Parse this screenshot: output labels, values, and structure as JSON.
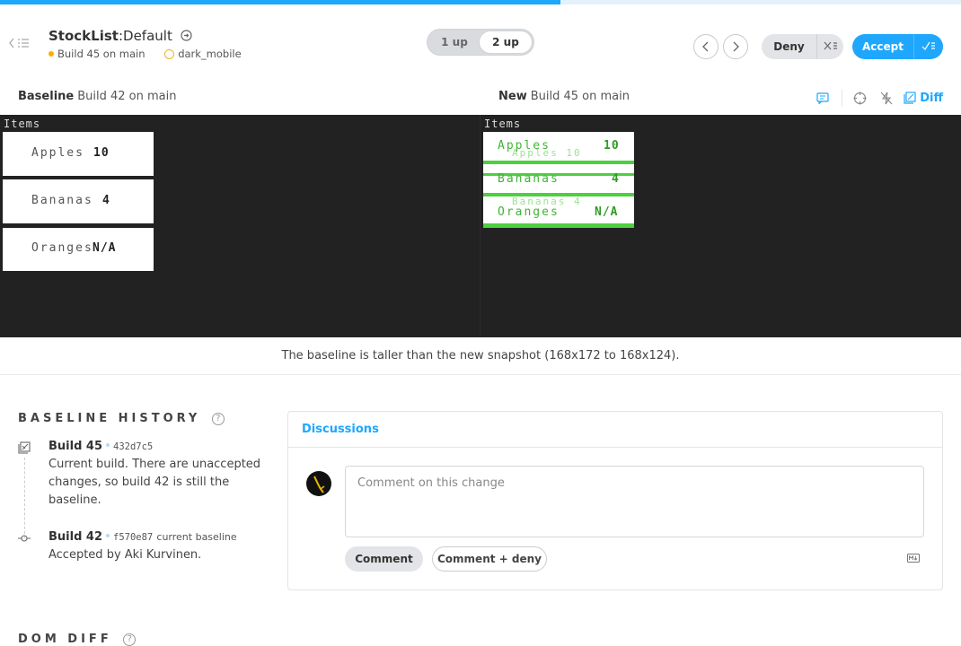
{
  "header": {
    "story": "StockList",
    "separator": ":",
    "variant": "Default",
    "build_label": "Build 45 on main",
    "browser_label": "dark_mobile"
  },
  "view_toggle": {
    "one_up": "1 up",
    "two_up": "2 up",
    "selected": "2 up"
  },
  "actions": {
    "deny": "Deny",
    "accept": "Accept"
  },
  "compare": {
    "baseline_title": "Baseline",
    "baseline_sub": "Build 42 on main",
    "new_title": "New",
    "new_sub": "Build 45 on main",
    "diff_label": "Diff"
  },
  "baseline_snapshot": {
    "heading": "Items",
    "rows": [
      {
        "name": "Apples",
        "qty": "10"
      },
      {
        "name": "Bananas",
        "qty": "4"
      },
      {
        "name": "Oranges",
        "qty": "N/A"
      }
    ]
  },
  "new_snapshot": {
    "heading": "Items",
    "rows": [
      {
        "name": "Apples",
        "qty": "10",
        "ghost": "Apples 10"
      },
      {
        "name": "Bananas",
        "qty": "4",
        "ghost": "Bananas 4"
      },
      {
        "name": "Oranges",
        "qty": "N/A"
      }
    ],
    "diff_color": "#4cd03f"
  },
  "notice": "The baseline is taller than the new snapshot (168x172 to 168x124).",
  "baseline_history": {
    "title": "BASELINE HISTORY",
    "entries": [
      {
        "build": "Build 45",
        "sha": "432d7c5",
        "note": "",
        "desc": "Current build. There are unaccepted changes, so build 42 is still the baseline."
      },
      {
        "build": "Build 42",
        "sha": "f570e87",
        "note": "current baseline",
        "desc": "Accepted by Aki Kurvinen."
      }
    ]
  },
  "discussions": {
    "title": "Discussions",
    "placeholder": "Comment on this change",
    "comment_btn": "Comment",
    "comment_deny_btn": "Comment + deny"
  },
  "dom_diff": {
    "title": "DOM DIFF"
  },
  "colors": {
    "accent": "#1ea7fd",
    "warning": "#ffae00",
    "canvas": "#222222"
  }
}
